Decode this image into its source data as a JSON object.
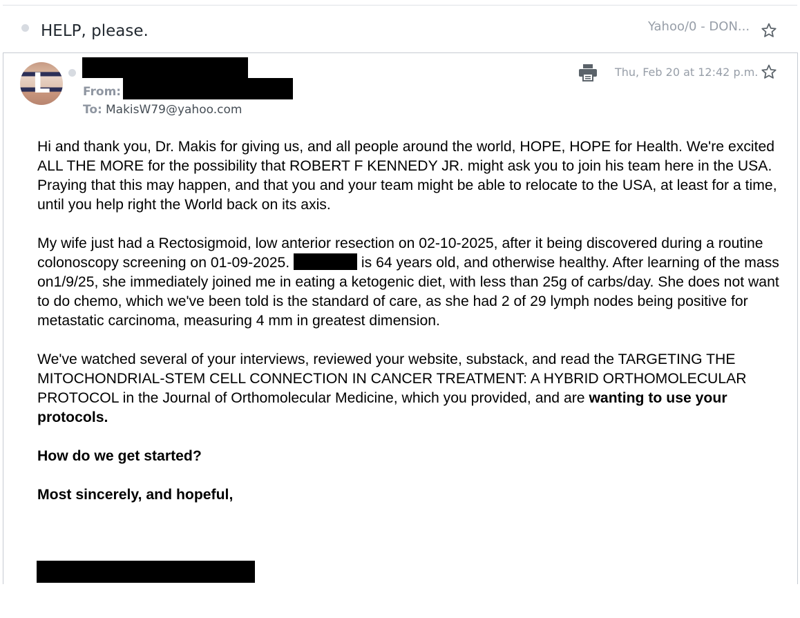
{
  "thread": {
    "subject": "HELP, please.",
    "folder": "Yahoo/0 - DON...",
    "star_icon": "star-outline-icon"
  },
  "message": {
    "avatar_letter": "L",
    "from_label": "From:",
    "to_label": "To:",
    "to_address": "MakisW79@yahoo.com",
    "date": "Thu, Feb 20 at 12:42 p.m.",
    "print_icon": "print-icon",
    "body": {
      "p1": "Hi and thank you, Dr. Makis for giving us, and all people around the world, HOPE, HOPE for Health.  We're excited  ALL THE MORE for the possibility that ROBERT F KENNEDY JR. might ask you to join his team here in the USA.  Praying that this may happen, and that you and your team might be able to relocate to the USA, at least for a time, until you help right the World back on its axis.",
      "p2_a": "My wife just had a Rectosigmoid, low anterior resection on 02-10-2025, after it being discovered during a routine colonoscopy screening on 01-09-2025. ",
      "p2_b": " is 64 years old, and otherwise healthy.  After learning of the mass on1/9/25, she immediately joined me in eating a ketogenic diet, with less than 25g of carbs/day.  She does not want to do chemo, which we've been told is the standard of care, as she had 2 of 29 lymph nodes being positive for metastatic carcinoma, measuring 4 mm in greatest dimension.",
      "p3_a": "We've watched several of your interviews, reviewed your website, substack, and read the TARGETING THE MITOCHONDRIAL-STEM CELL CONNECTION IN CANCER TREATMENT: A HYBRID ORTHOMOLECULAR PROTOCOL in the Journal of Orthomolecular Medicine, which you provided, and are ",
      "p3_bold": "wanting to use your protocols.",
      "p4": "How do we get started?",
      "p5": "Most sincerely, and hopeful,"
    }
  }
}
